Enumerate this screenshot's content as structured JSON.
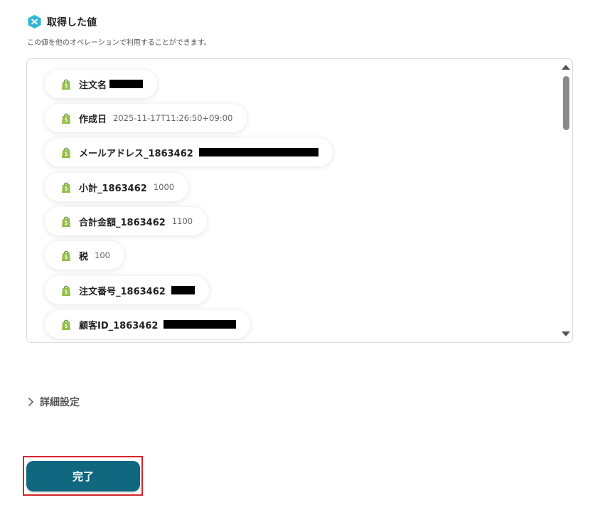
{
  "header": {
    "title": "取得した値",
    "description": "この値を他のオペレーションで利用することができます。",
    "icon": "yoom-logo-icon",
    "accent_color": "#2fb5d5"
  },
  "fields": [
    {
      "label": "注文名",
      "value": "",
      "redacted": true
    },
    {
      "label": "作成日",
      "value": "2025-11-17T11:26:50+09:00",
      "redacted": false
    },
    {
      "label": "メールアドレス_1863462",
      "value": "",
      "redacted": true
    },
    {
      "label": "小計_1863462",
      "value": "1000",
      "redacted": false
    },
    {
      "label": "合計金額_1863462",
      "value": "1100",
      "redacted": false
    },
    {
      "label": "税",
      "value": "100",
      "redacted": false
    },
    {
      "label": "注文番号_1863462",
      "value": "",
      "redacted": true
    },
    {
      "label": "顧客ID_1863462",
      "value": "",
      "redacted": true
    }
  ],
  "field_icon": "shopify-bag-icon",
  "details": {
    "label": "詳細設定",
    "icon": "chevron-right-icon"
  },
  "done_button": {
    "label": "完了",
    "color": "#0f6780"
  }
}
